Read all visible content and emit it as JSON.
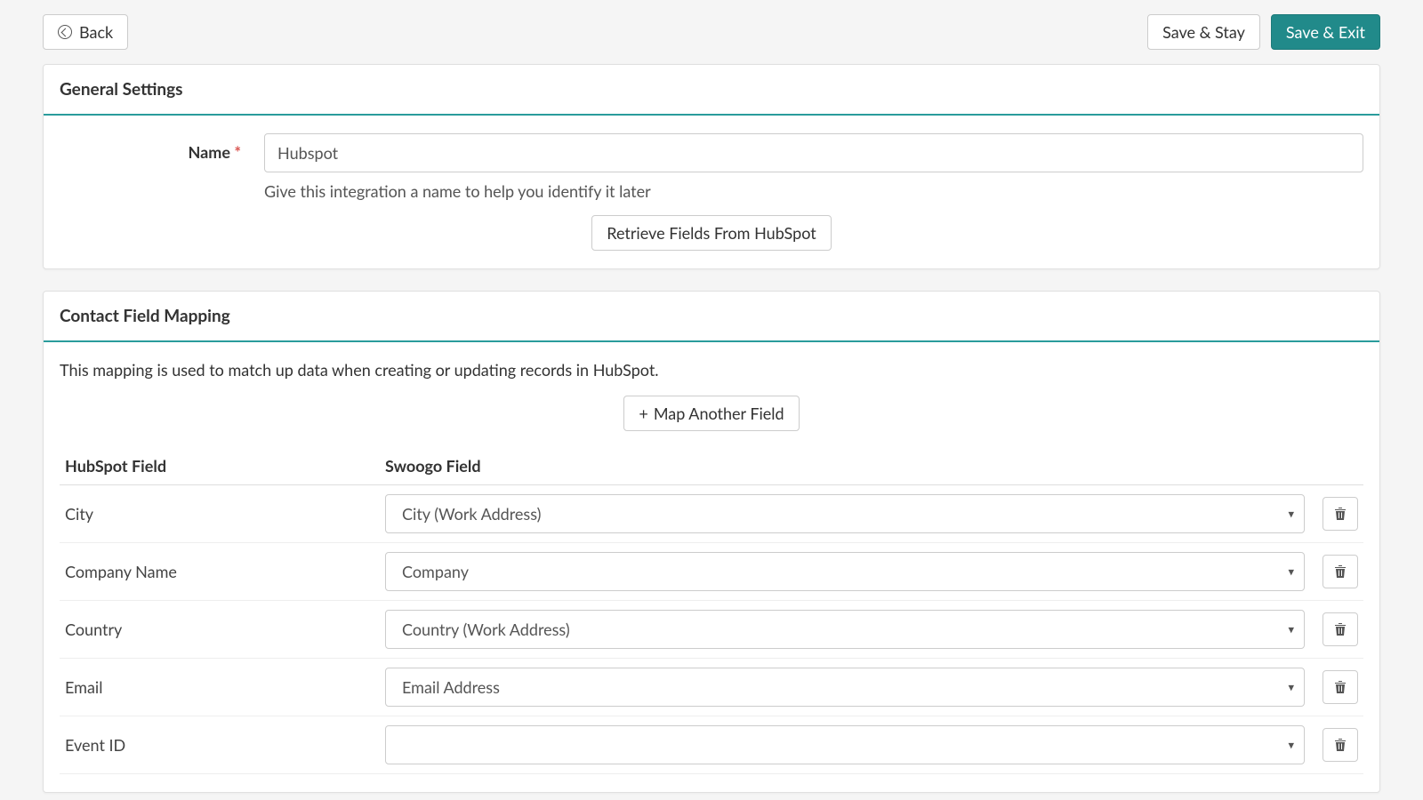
{
  "topbar": {
    "back_label": "Back",
    "save_stay_label": "Save & Stay",
    "save_exit_label": "Save & Exit"
  },
  "general": {
    "header": "General Settings",
    "name_label": "Name",
    "name_value": "Hubspot",
    "name_help": "Give this integration a name to help you identify it later",
    "retrieve_label": "Retrieve Fields From HubSpot"
  },
  "mapping": {
    "header": "Contact Field Mapping",
    "description": "This mapping is used to match up data when creating or updating records in HubSpot.",
    "add_label": "Map Another Field",
    "col_hubspot": "HubSpot Field",
    "col_swoogo": "Swoogo Field",
    "rows": [
      {
        "hubspot": "City",
        "swoogo": "City (Work Address)"
      },
      {
        "hubspot": "Company Name",
        "swoogo": "Company"
      },
      {
        "hubspot": "Country",
        "swoogo": "Country (Work Address)"
      },
      {
        "hubspot": "Email",
        "swoogo": "Email Address"
      },
      {
        "hubspot": "Event ID",
        "swoogo": ""
      }
    ]
  }
}
